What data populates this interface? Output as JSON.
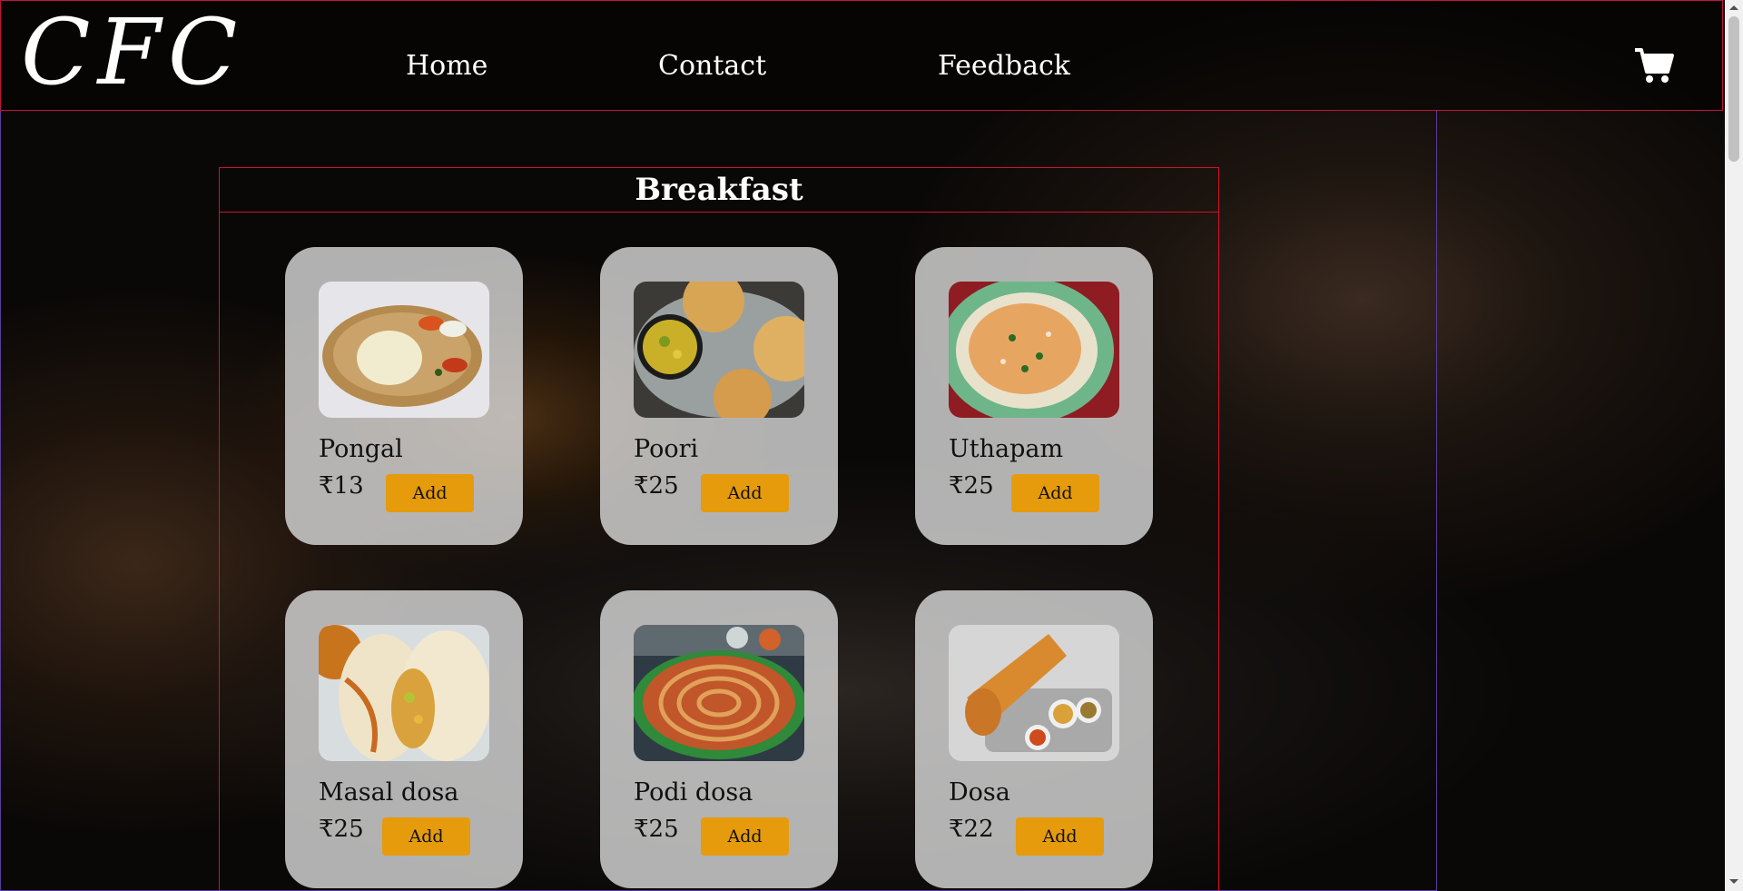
{
  "header": {
    "logo": "CFC",
    "nav": [
      {
        "label": "Home"
      },
      {
        "label": "Contact"
      },
      {
        "label": "Feedback"
      }
    ],
    "cart_icon": "shopping-cart-icon"
  },
  "section": {
    "title": "Breakfast",
    "items": [
      {
        "name": "Pongal",
        "price": "₹13",
        "button": "Add",
        "image": "pongal-image"
      },
      {
        "name": "Poori",
        "price": "₹25",
        "button": "Add",
        "image": "poori-image"
      },
      {
        "name": "Uthapam",
        "price": "₹25",
        "button": "Add",
        "image": "uthapam-image"
      },
      {
        "name": "Masal dosa",
        "price": "₹25",
        "button": "Add",
        "image": "masal-dosa-image"
      },
      {
        "name": "Podi dosa",
        "price": "₹25",
        "button": "Add",
        "image": "podi-dosa-image"
      },
      {
        "name": "Dosa",
        "price": "₹22",
        "button": "Add",
        "image": "dosa-image"
      }
    ]
  },
  "colors": {
    "accent": "#e59b0c",
    "frame_border": "#d0102c",
    "outer_frame": "#5a3c9a"
  }
}
